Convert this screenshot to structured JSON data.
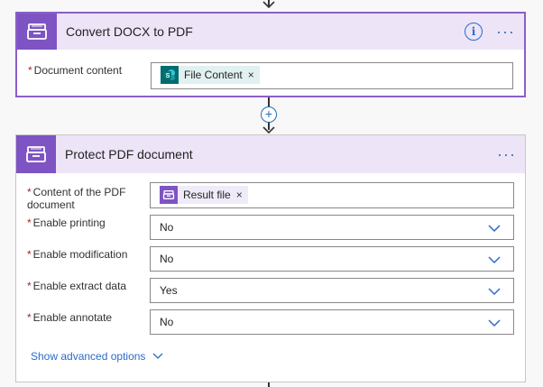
{
  "card1": {
    "title": "Convert DOCX to PDF",
    "info_icon": "i",
    "fields": [
      {
        "label": "Document content",
        "token": "File Content"
      }
    ]
  },
  "card2": {
    "title": "Protect PDF document",
    "fields": [
      {
        "label": "Content of the PDF document",
        "token": "Result file"
      },
      {
        "label": "Enable printing",
        "value": "No"
      },
      {
        "label": "Enable modification",
        "value": "No"
      },
      {
        "label": "Enable extract data",
        "value": "Yes"
      },
      {
        "label": "Enable annotate",
        "value": "No"
      }
    ],
    "advanced_label": "Show advanced options"
  },
  "common": {
    "required_marker": "*",
    "more_icon": "···",
    "remove_icon": "×",
    "add_step_icon": "+"
  },
  "colors": {
    "accent_purple": "#7e54c4",
    "header_bg": "#ede4f7",
    "link_blue": "#2a6cc9",
    "sharepoint_teal": "#036c70"
  }
}
